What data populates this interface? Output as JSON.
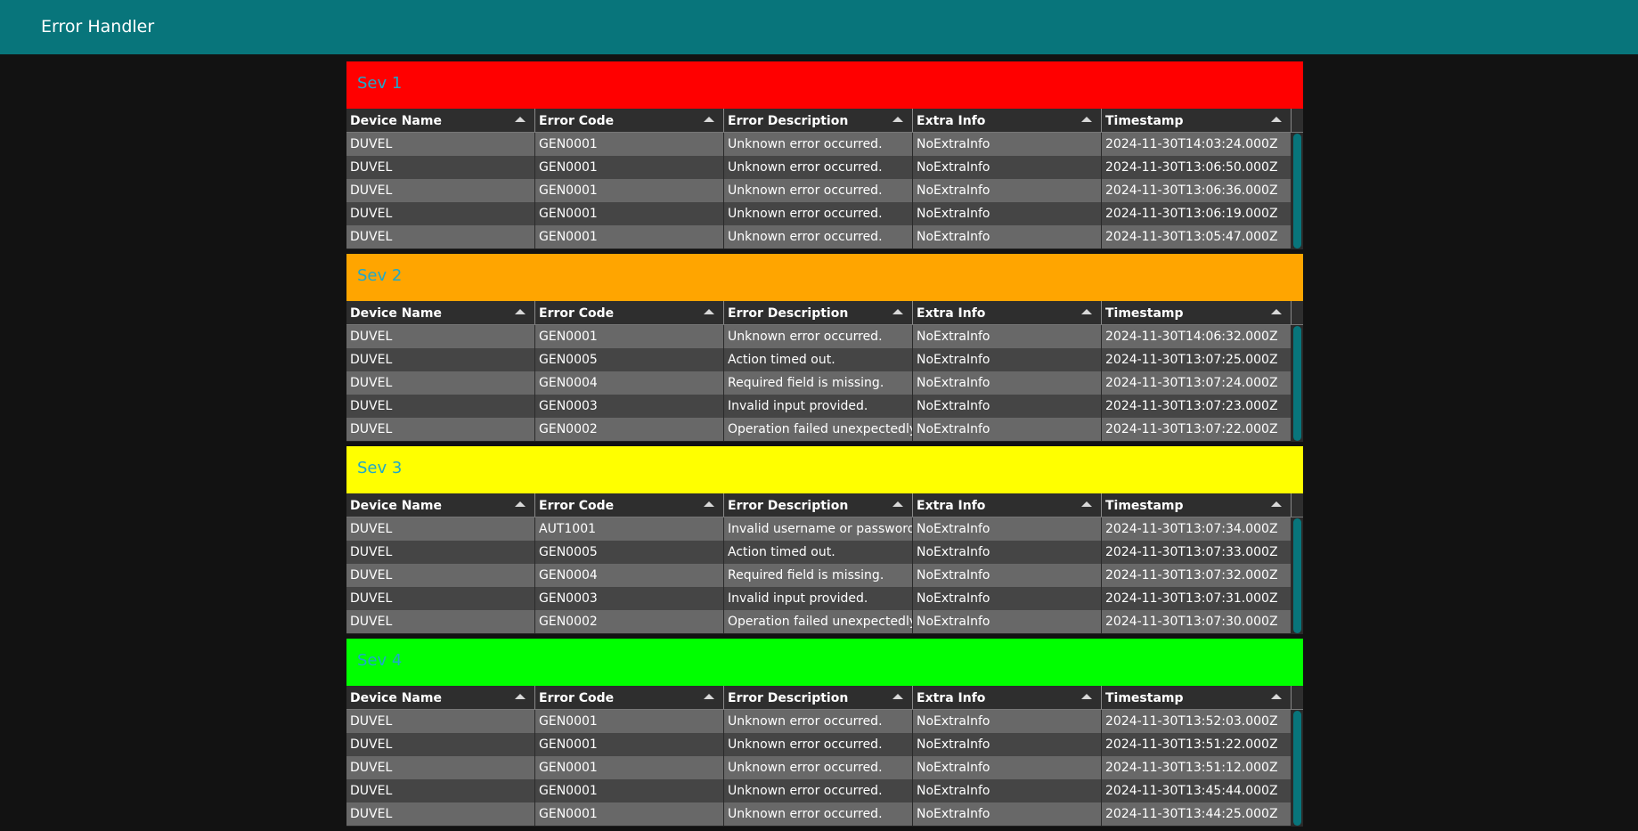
{
  "app": {
    "title": "Error Handler"
  },
  "columns": [
    "Device Name",
    "Error Code",
    "Error Description",
    "Extra Info",
    "Timestamp"
  ],
  "panels": [
    {
      "title": "Sev 1",
      "color": "#ff0000",
      "rows": [
        [
          "DUVEL",
          "GEN0001",
          "Unknown error occurred.",
          "NoExtraInfo",
          "2024-11-30T14:03:24.000Z"
        ],
        [
          "DUVEL",
          "GEN0001",
          "Unknown error occurred.",
          "NoExtraInfo",
          "2024-11-30T13:06:50.000Z"
        ],
        [
          "DUVEL",
          "GEN0001",
          "Unknown error occurred.",
          "NoExtraInfo",
          "2024-11-30T13:06:36.000Z"
        ],
        [
          "DUVEL",
          "GEN0001",
          "Unknown error occurred.",
          "NoExtraInfo",
          "2024-11-30T13:06:19.000Z"
        ],
        [
          "DUVEL",
          "GEN0001",
          "Unknown error occurred.",
          "NoExtraInfo",
          "2024-11-30T13:05:47.000Z"
        ]
      ]
    },
    {
      "title": "Sev 2",
      "color": "#ffa500",
      "rows": [
        [
          "DUVEL",
          "GEN0001",
          "Unknown error occurred.",
          "NoExtraInfo",
          "2024-11-30T14:06:32.000Z"
        ],
        [
          "DUVEL",
          "GEN0005",
          "Action timed out.",
          "NoExtraInfo",
          "2024-11-30T13:07:25.000Z"
        ],
        [
          "DUVEL",
          "GEN0004",
          "Required field is missing.",
          "NoExtraInfo",
          "2024-11-30T13:07:24.000Z"
        ],
        [
          "DUVEL",
          "GEN0003",
          "Invalid input provided.",
          "NoExtraInfo",
          "2024-11-30T13:07:23.000Z"
        ],
        [
          "DUVEL",
          "GEN0002",
          "Operation failed unexpectedly.",
          "NoExtraInfo",
          "2024-11-30T13:07:22.000Z"
        ]
      ]
    },
    {
      "title": "Sev 3",
      "color": "#ffff00",
      "rows": [
        [
          "DUVEL",
          "AUT1001",
          "Invalid username or password.",
          "NoExtraInfo",
          "2024-11-30T13:07:34.000Z"
        ],
        [
          "DUVEL",
          "GEN0005",
          "Action timed out.",
          "NoExtraInfo",
          "2024-11-30T13:07:33.000Z"
        ],
        [
          "DUVEL",
          "GEN0004",
          "Required field is missing.",
          "NoExtraInfo",
          "2024-11-30T13:07:32.000Z"
        ],
        [
          "DUVEL",
          "GEN0003",
          "Invalid input provided.",
          "NoExtraInfo",
          "2024-11-30T13:07:31.000Z"
        ],
        [
          "DUVEL",
          "GEN0002",
          "Operation failed unexpectedly.",
          "NoExtraInfo",
          "2024-11-30T13:07:30.000Z"
        ]
      ]
    },
    {
      "title": "Sev 4",
      "color": "#00ff00",
      "rows": [
        [
          "DUVEL",
          "GEN0001",
          "Unknown error occurred.",
          "NoExtraInfo",
          "2024-11-30T13:52:03.000Z"
        ],
        [
          "DUVEL",
          "GEN0001",
          "Unknown error occurred.",
          "NoExtraInfo",
          "2024-11-30T13:51:22.000Z"
        ],
        [
          "DUVEL",
          "GEN0001",
          "Unknown error occurred.",
          "NoExtraInfo",
          "2024-11-30T13:51:12.000Z"
        ],
        [
          "DUVEL",
          "GEN0001",
          "Unknown error occurred.",
          "NoExtraInfo",
          "2024-11-30T13:45:44.000Z"
        ],
        [
          "DUVEL",
          "GEN0001",
          "Unknown error occurred.",
          "NoExtraInfo",
          "2024-11-30T13:44:25.000Z"
        ]
      ]
    }
  ]
}
